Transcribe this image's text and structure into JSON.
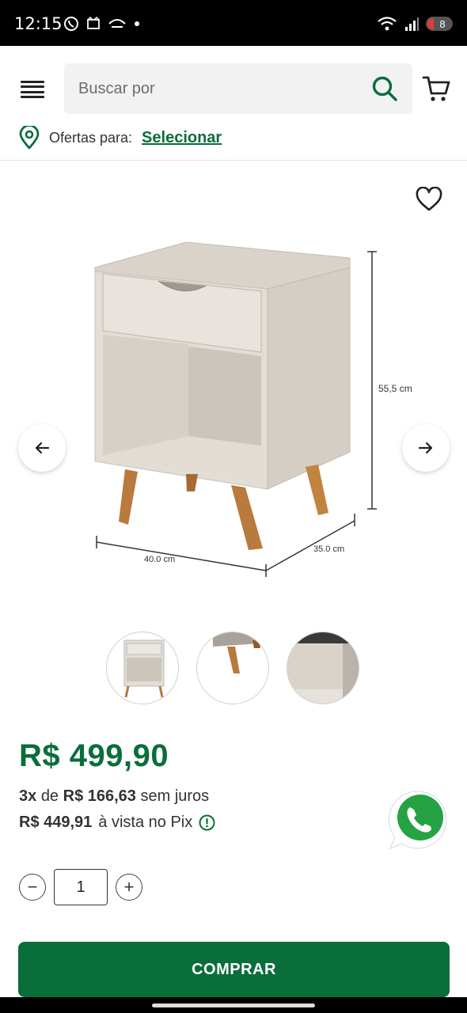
{
  "status_bar": {
    "time": "12:15",
    "battery": "8"
  },
  "header": {
    "search_placeholder": "Buscar por",
    "menu_icon": "hamburger-menu-icon",
    "search_icon": "search-icon",
    "cart_icon": "cart-icon"
  },
  "offers": {
    "label": "Ofertas para:",
    "link": "Selecionar",
    "icon": "location-pin-icon"
  },
  "product": {
    "dimension_height": "55,5 cm",
    "dimension_width": "40.0 cm",
    "dimension_depth": "35.0 cm",
    "thumbnails_count": 3
  },
  "pricing": {
    "price": "R$ 499,90",
    "installments_count": "3x",
    "installments_de": "de",
    "installments_value": "R$ 166,63",
    "installments_suffix": "sem juros",
    "pix_value": "R$ 449,91",
    "pix_suffix": "à vista no Pix"
  },
  "quantity": {
    "value": "1",
    "minus": "−",
    "plus": "+"
  },
  "actions": {
    "buy_label": "COMPRAR"
  },
  "colors": {
    "brand_green": "#0a6e3a",
    "whatsapp_green": "#25a244"
  }
}
